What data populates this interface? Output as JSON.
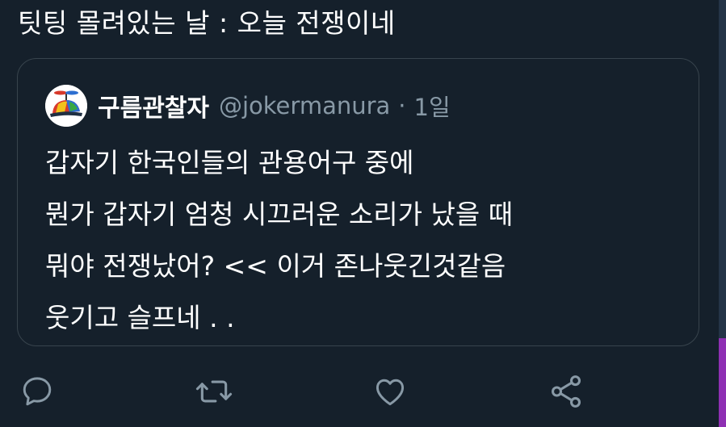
{
  "tweet": {
    "text": "팃팅 몰려있는 날 : 오늘 전쟁이네"
  },
  "quoted_tweet": {
    "author_name": "구름관찰자",
    "handle": "@jokermanura",
    "separator": "·",
    "time": "1일",
    "lines": [
      "갑자기 한국인들의 관용어구 중에",
      "뭔가 갑자기 엄청 시끄러운 소리가 났을 때",
      "뭐야 전쟁났어? << 이거 존나웃긴것같음",
      "웃기고 슬프네 . ."
    ]
  },
  "actions": {
    "reply_icon": "speech-bubble",
    "retweet_icon": "retweet-arrows",
    "like_icon": "heart-outline",
    "share_icon": "share-nodes"
  },
  "colors": {
    "background": "#15202b",
    "text": "#ffffff",
    "secondary_text": "#8899a6",
    "border": "#38444d",
    "icon": "#8899a6"
  }
}
